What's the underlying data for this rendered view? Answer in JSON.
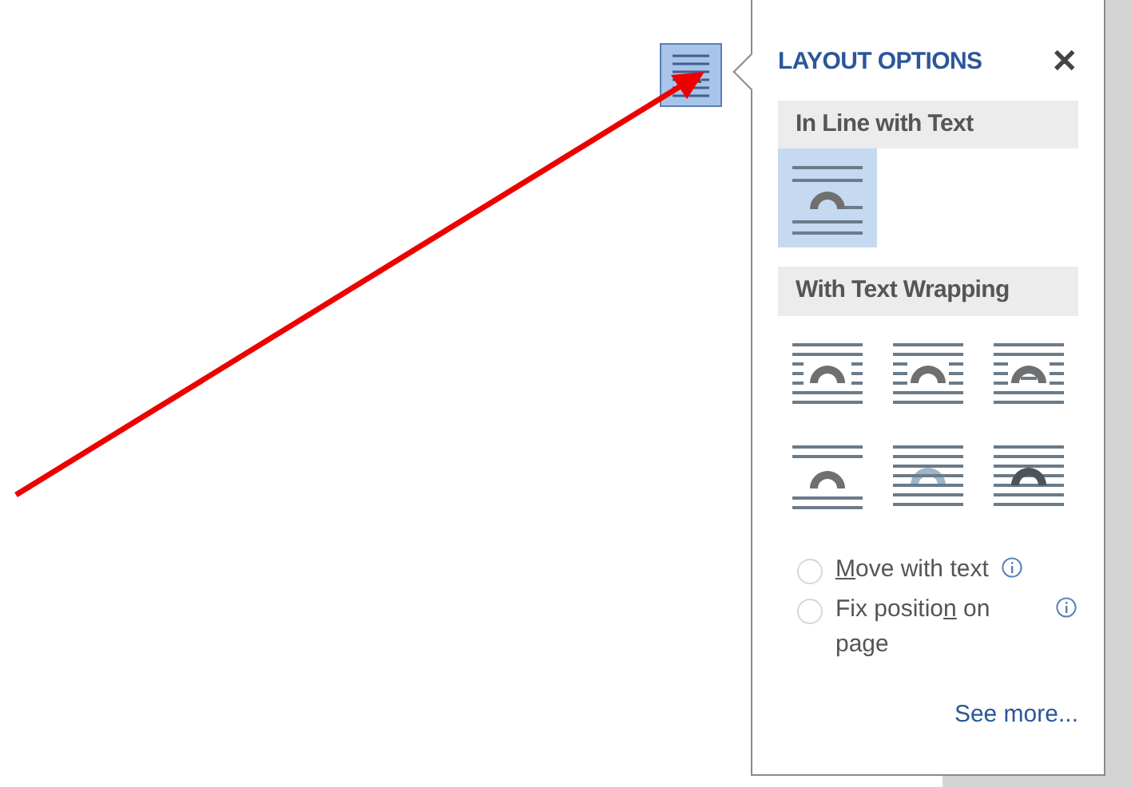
{
  "layout_button": {
    "selected": true
  },
  "panel": {
    "title": "LAYOUT OPTIONS",
    "close": "✕",
    "sections": [
      {
        "heading": "In Line with Text",
        "options": [
          {
            "kind": "inline",
            "selected": true
          }
        ]
      },
      {
        "heading": "With Text Wrapping",
        "options": [
          {
            "kind": "square",
            "selected": false
          },
          {
            "kind": "tight",
            "selected": false
          },
          {
            "kind": "through",
            "selected": false
          },
          {
            "kind": "topbottom",
            "selected": false
          },
          {
            "kind": "behind",
            "selected": false
          },
          {
            "kind": "front",
            "selected": false
          }
        ]
      }
    ],
    "radios": [
      {
        "key": "M",
        "after": "ove with text",
        "selected": false
      },
      {
        "before": "Fix positio",
        "key": "n",
        "after": " on page",
        "selected": false
      }
    ],
    "see_more": "See more..."
  }
}
